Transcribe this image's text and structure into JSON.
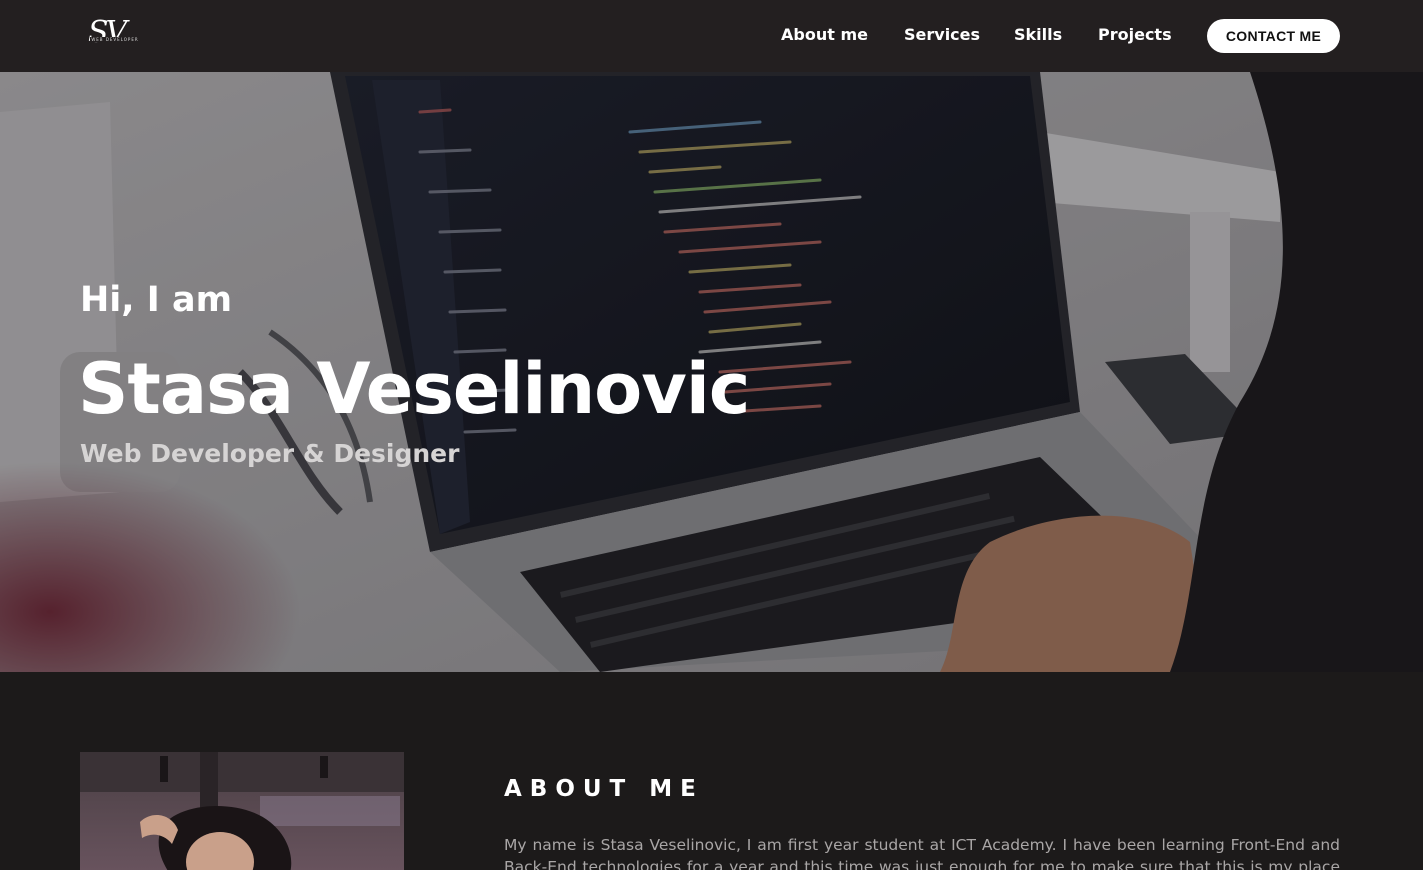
{
  "header": {
    "logo_text": "SV",
    "logo_subtext": "WEB DEVELOPER",
    "nav": {
      "about": "About me",
      "services": "Services",
      "skills": "Skills",
      "projects": "Projects"
    },
    "contact_label": "CONTACT ME"
  },
  "hero": {
    "greeting": "Hi, I am",
    "name": "Stasa Veselinovic",
    "role": "Web Developer & Designer"
  },
  "about": {
    "title": "ABOUT ME",
    "text": "My name is Stasa Veselinovic, I am first year student at ICT Academy. I have been learning Front-End and Back-End technologies for a year and this time was just enough for me to make sure that this is my place in the"
  },
  "colors": {
    "navbar_bg": "#231f20",
    "page_bg": "#1c1a1a",
    "contact_button_bg": "#ffffff",
    "body_text": "#a9a6a6"
  }
}
